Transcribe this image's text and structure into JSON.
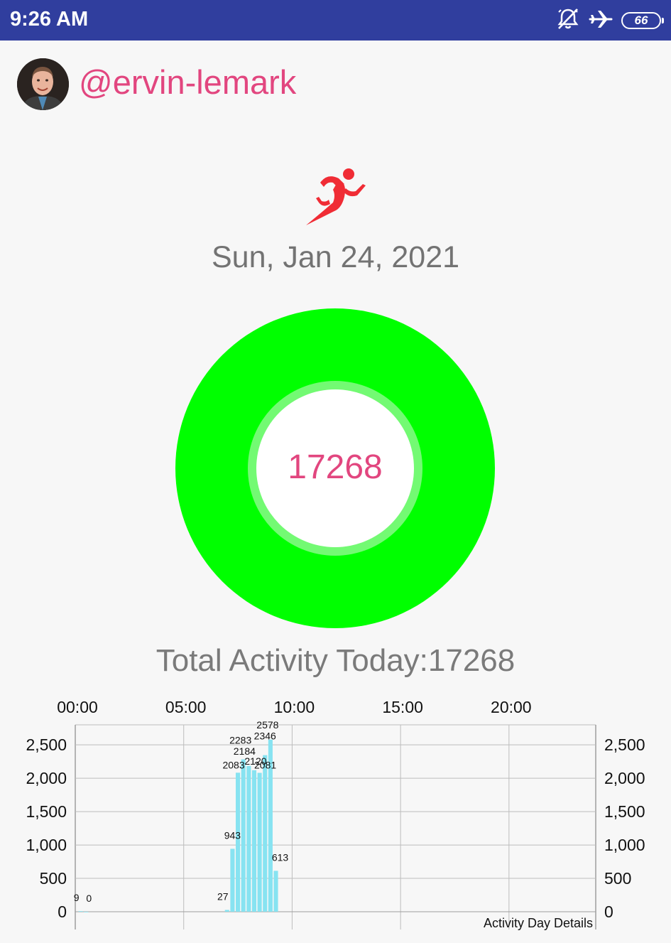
{
  "status_bar": {
    "time": "9:26 AM",
    "icons": [
      "alarm-off-icon",
      "airplane-mode-icon",
      "battery-icon"
    ],
    "battery_level": "66"
  },
  "profile": {
    "username": "@ervin-lemark",
    "avatar": "avatar"
  },
  "activity_icon": "running-person-icon",
  "date": "Sun, Jan 24, 2021",
  "ring": {
    "value": "17268",
    "colors": {
      "outer": "#00ff00",
      "inner_border": "#73fa73",
      "center": "#ffffff",
      "value_text": "#e2467f"
    }
  },
  "total_activity": "Total Activity Today:17268",
  "colors": {
    "status_bar": "#303e9e",
    "accent_pink": "#e2467f",
    "bar": "#87e3f1",
    "grid": "#bdbdbd"
  },
  "chart_data": {
    "type": "bar",
    "description": "Activity Day Details",
    "x_axis": {
      "position": "top",
      "range": [
        0,
        24
      ],
      "unit": "hours",
      "tick_values": [
        0,
        5,
        10,
        15,
        20
      ],
      "tick_labels": [
        "00:00",
        "05:00",
        "10:00",
        "15:00",
        "20:00"
      ]
    },
    "y_axis": {
      "range": [
        0,
        2800
      ],
      "tick_values": [
        0,
        500,
        1000,
        1500,
        2000,
        2500
      ],
      "tick_labels": [
        "0",
        "2,500",
        "2,000",
        "1,500",
        "1,000",
        "500"
      ],
      "tick_labels_ordered": [
        "0",
        "500",
        "1,000",
        "1,500",
        "2,000",
        "2,500"
      ],
      "show_left": true,
      "show_right": true
    },
    "grid": true,
    "bars": [
      {
        "time": 0.25,
        "value": 9,
        "label": "9"
      },
      {
        "time": 0.5,
        "value": 0,
        "label": "0"
      },
      {
        "time": 7.0,
        "value": 27,
        "label": "27"
      },
      {
        "time": 7.25,
        "value": 943,
        "label": "943"
      },
      {
        "time": 7.5,
        "value": 2083,
        "label": "2083"
      },
      {
        "time": 7.75,
        "value": 2283,
        "label": "2283"
      },
      {
        "time": 8.0,
        "value": 2184,
        "label": "2184"
      },
      {
        "time": 8.25,
        "value": 2120,
        "label": "2120"
      },
      {
        "time": 8.5,
        "value": 2081,
        "label": "2081"
      },
      {
        "time": 8.75,
        "value": 2346,
        "label": "2346"
      },
      {
        "time": 9.0,
        "value": 2578,
        "label": "2578"
      },
      {
        "time": 9.25,
        "value": 613,
        "label": "613"
      }
    ]
  }
}
